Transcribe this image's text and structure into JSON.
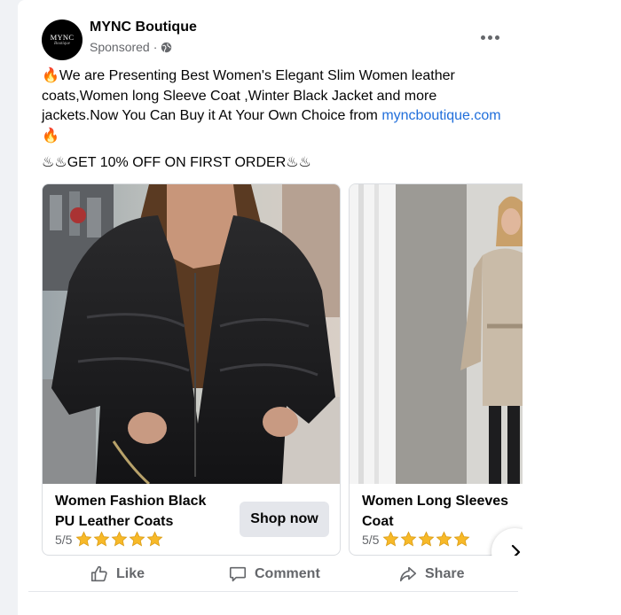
{
  "post": {
    "page_name": "MYNC Boutique",
    "avatar_text": "MYNC",
    "avatar_subtext": "Boutique",
    "sponsored": "Sponsored",
    "sponsored_separator": "·",
    "audience_icon": "globe-icon",
    "more_icon": "more-horizontal-icon",
    "text_emoji": "🔥",
    "text_body": "We are Presenting Best Women's Elegant Slim Women leather coats,Women long Sleeve Coat ,Winter Black Jacket and more jackets.Now You Can Buy it At Your Own Choice from",
    "text_link": "myncboutique.com",
    "promo": "♨♨GET 10% OFF ON FIRST ORDER♨♨"
  },
  "carousel": {
    "items": [
      {
        "title_line1": "Women Fashion Black",
        "title_line2": "PU Leather Coats",
        "rating": "5/5",
        "stars": 5,
        "cta": "Shop now"
      },
      {
        "title_line1": "Women Long Sleeves",
        "title_line2": "Coat",
        "rating": "5/5",
        "stars": 5
      }
    ],
    "next_icon": "chevron-right-icon"
  },
  "actions": {
    "like": "Like",
    "comment": "Comment",
    "share": "Share"
  },
  "colors": {
    "link": "#216fdb",
    "secondary_text": "#65676b",
    "button_bg": "#e4e6eb",
    "star": "#f7b928"
  }
}
